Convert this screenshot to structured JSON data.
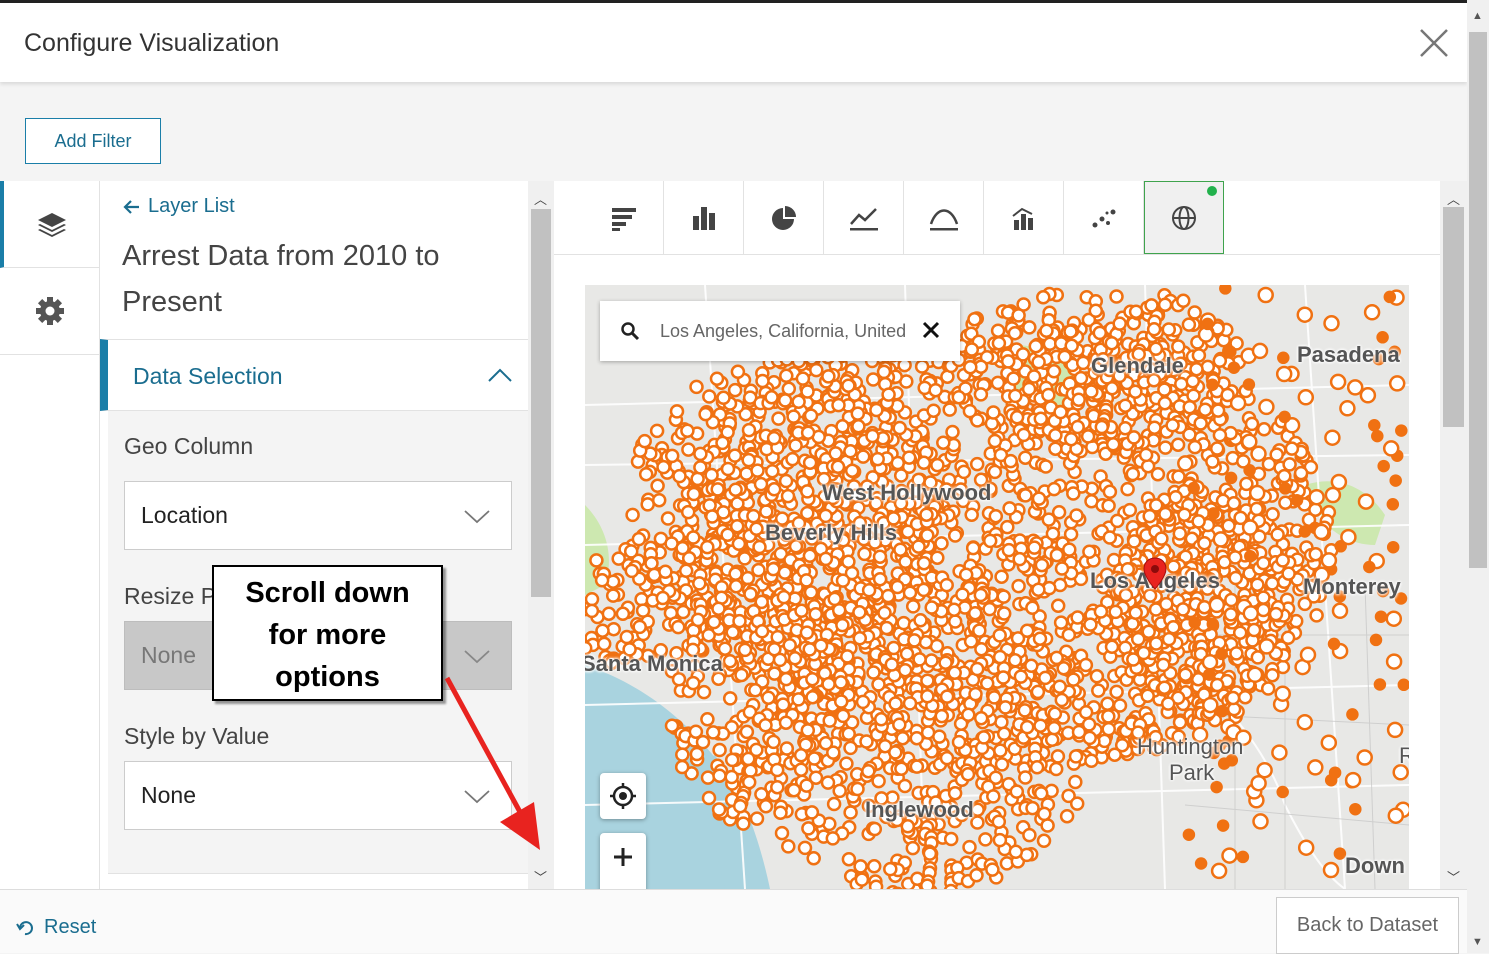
{
  "dialog": {
    "title": "Configure Visualization",
    "close_icon": "close-icon"
  },
  "filters": {
    "add_filter_label": "Add Filter"
  },
  "sidenav": {
    "items": [
      {
        "name": "layers",
        "icon": "layers-icon",
        "active": true
      },
      {
        "name": "settings",
        "icon": "gear-icon",
        "active": false
      }
    ]
  },
  "layer_panel": {
    "back_label": "Layer List",
    "layer_title": "Arrest Data from 2010 to Present",
    "section": {
      "label": "Data Selection",
      "expanded": true
    },
    "fields": {
      "geo_column": {
        "label": "Geo Column",
        "value": "Location"
      },
      "resize_points": {
        "label": "Resize Po",
        "value": "None",
        "disabled": true
      },
      "style_by_value": {
        "label": "Style by Value",
        "value": "None"
      }
    }
  },
  "toolbar": {
    "chart_types": [
      {
        "name": "table",
        "icon": "table-bars-icon",
        "active": false
      },
      {
        "name": "column",
        "icon": "column-chart-icon",
        "active": false
      },
      {
        "name": "pie",
        "icon": "pie-chart-icon",
        "active": false
      },
      {
        "name": "line",
        "icon": "line-chart-icon",
        "active": false
      },
      {
        "name": "area",
        "icon": "area-chart-icon",
        "active": false
      },
      {
        "name": "combo",
        "icon": "combo-chart-icon",
        "active": false
      },
      {
        "name": "scatter",
        "icon": "scatter-chart-icon",
        "active": false
      },
      {
        "name": "map",
        "icon": "globe-icon",
        "active": true
      }
    ]
  },
  "map": {
    "search_value": "Los Angeles, California, United",
    "places": [
      {
        "id": "glendale",
        "label": "Glendale"
      },
      {
        "id": "pasadena",
        "label": "Pasadena"
      },
      {
        "id": "west-hollywood",
        "label": "West Hollywood"
      },
      {
        "id": "beverly-hills",
        "label": "Beverly Hills"
      },
      {
        "id": "los-angeles",
        "label": "Los Angeles"
      },
      {
        "id": "monterey",
        "label": "Monterey"
      },
      {
        "id": "santa-monica",
        "label": "Santa Monica"
      },
      {
        "id": "huntington-park-1",
        "label": "Huntington"
      },
      {
        "id": "huntington-park-2",
        "label": "Park"
      },
      {
        "id": "inglewood",
        "label": "Inglewood"
      },
      {
        "id": "downey",
        "label": "Down"
      },
      {
        "id": "edge-r",
        "label": "R"
      }
    ],
    "colors": {
      "point": "#f07112",
      "water": "#a9d3df",
      "park": "#cde8b0",
      "land": "#e8e8e6",
      "marker": "#e8231f"
    }
  },
  "annotation": {
    "text_line1": "Scroll down",
    "text_line2": "for more",
    "text_line3": "options",
    "arrow_color": "#e8231f"
  },
  "footer": {
    "reset_label": "Reset",
    "back_label": "Back to Dataset"
  }
}
